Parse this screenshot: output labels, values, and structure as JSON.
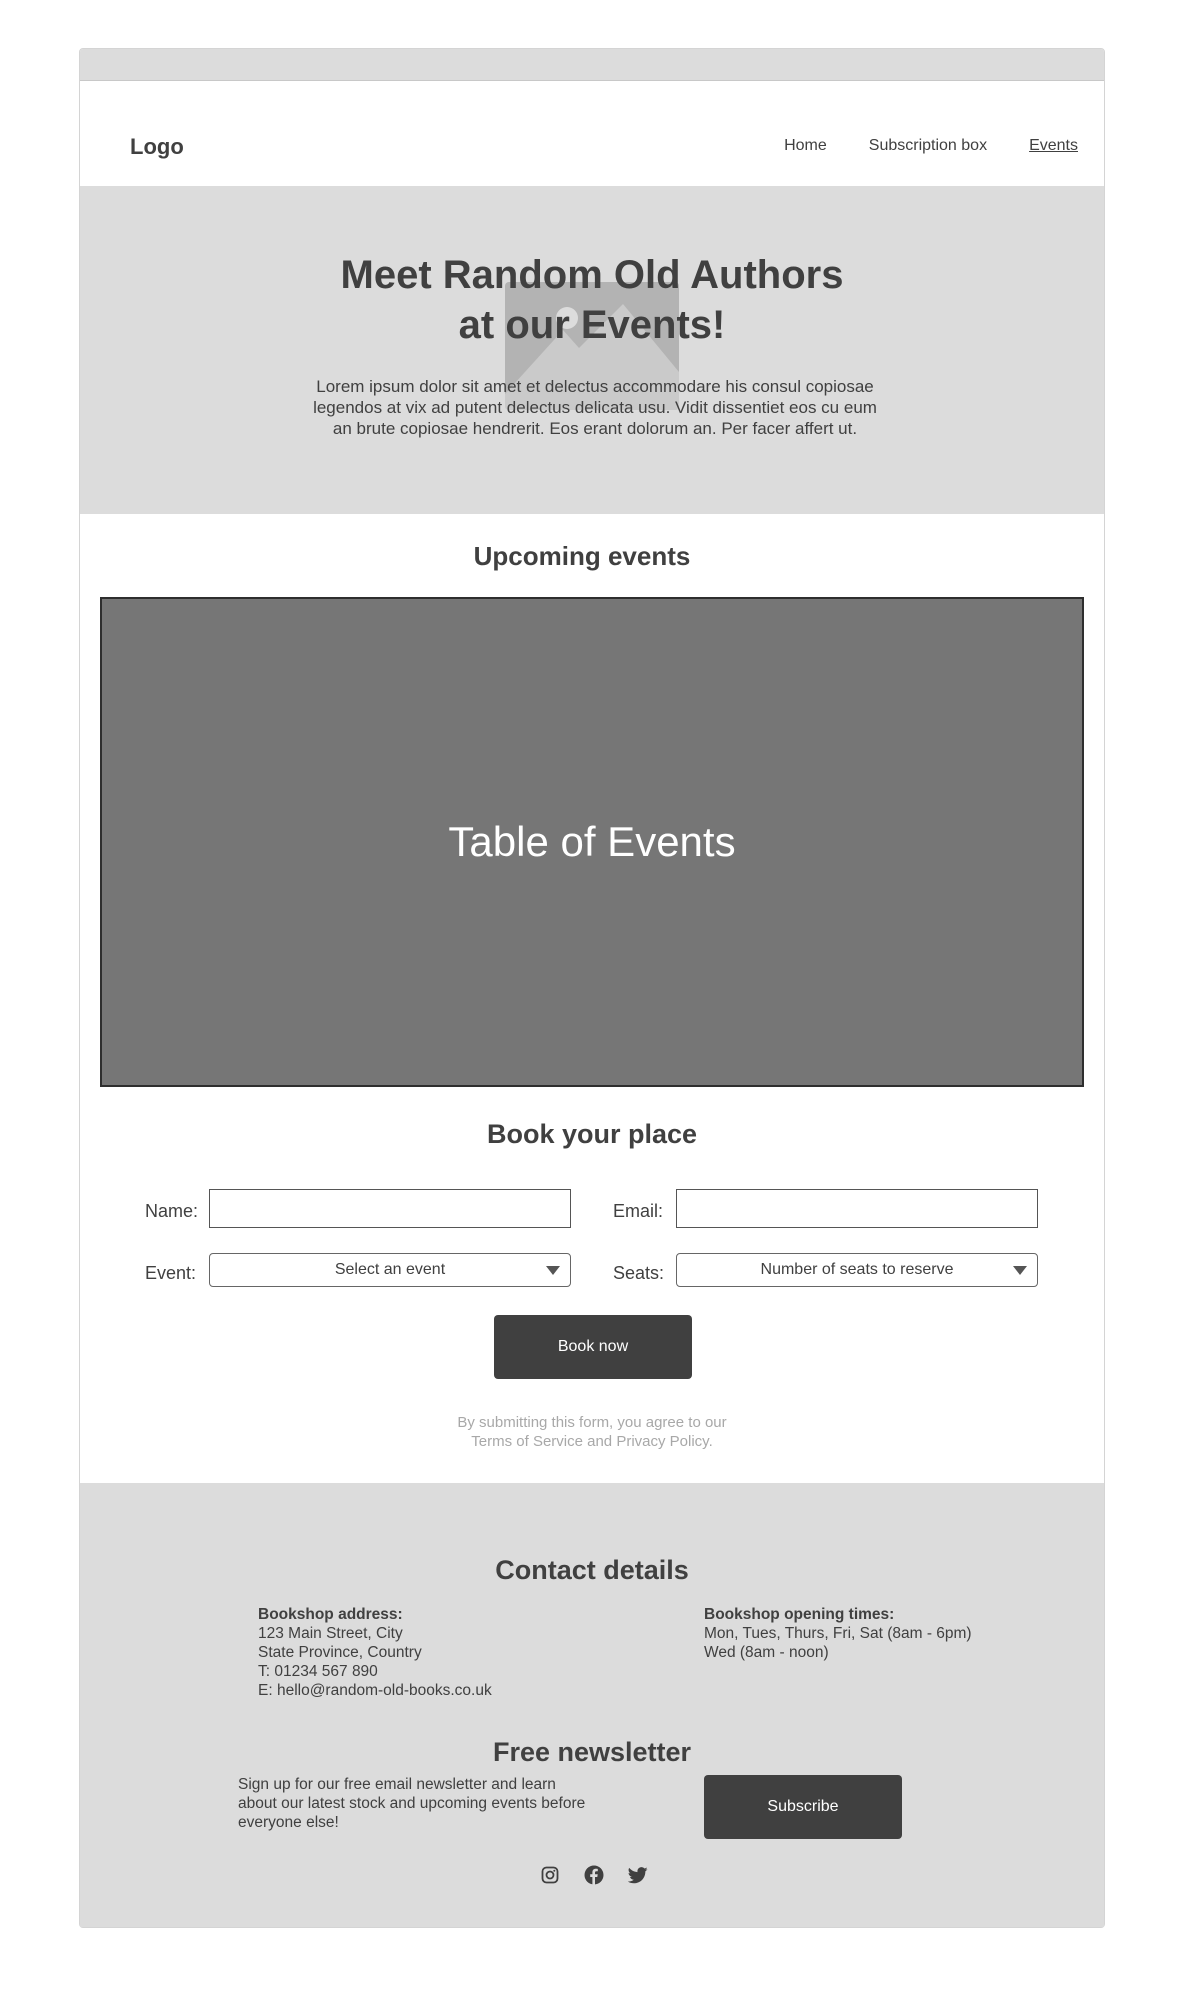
{
  "header": {
    "logo": "Logo",
    "nav": [
      {
        "label": "Home",
        "active": false
      },
      {
        "label": "Subscription box",
        "active": false
      },
      {
        "label": "Events",
        "active": true
      }
    ]
  },
  "hero": {
    "title_line1": "Meet Random Old Authors",
    "title_line2": "at our Events!",
    "text": "Lorem ipsum dolor sit amet et delectus accommodare his consul copiosae legendos at vix ad putent delectus delicata usu. Vidit dissentiet eos cu eum an brute copiosae hendrerit. Eos erant dolorum an. Per facer affert ut.",
    "image_icon": "image-placeholder-icon"
  },
  "events": {
    "title": "Upcoming events",
    "table_label": "Table of Events"
  },
  "booking": {
    "title": "Book your place",
    "name_label": "Name:",
    "email_label": "Email:",
    "event_label": "Event:",
    "seats_label": "Seats:",
    "event_placeholder": "Select an event",
    "seats_placeholder": "Number of seats to reserve",
    "name_value": "",
    "email_value": "",
    "submit_label": "Book now",
    "disclaimer_line1": "By submitting this form, you agree to our",
    "disclaimer_line2": "Terms of Service and Privacy Policy."
  },
  "footer": {
    "contact_title": "Contact details",
    "address_head": "Bookshop address:",
    "address_line1": "123 Main Street, City",
    "address_line2": "State Province, Country",
    "phone": "T: 01234 567 890",
    "email": "E: hello@random-old-books.co.uk",
    "hours_head": "Bookshop opening times:",
    "hours_line1": "Mon, Tues, Thurs, Fri, Sat (8am - 6pm)",
    "hours_line2": "Wed (8am - noon)",
    "newsletter_title": "Free newsletter",
    "newsletter_text": "Sign up for our free email newsletter and learn about our latest stock and upcoming events before everyone else!",
    "subscribe_label": "Subscribe",
    "socials": [
      "instagram-icon",
      "facebook-icon",
      "twitter-icon"
    ]
  },
  "colors": {
    "dark": "#404040",
    "grey_bg": "#dcdcdc",
    "table_bg": "#767676"
  }
}
